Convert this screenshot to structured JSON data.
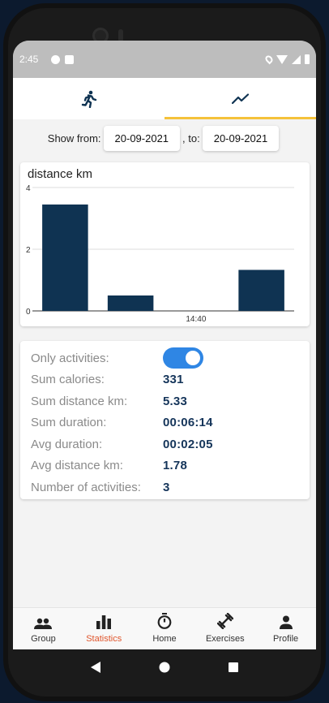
{
  "status": {
    "time": "2:45",
    "left_icons": [
      "media-icon",
      "sd-card-icon"
    ],
    "right_icons": [
      "location-icon",
      "wifi-icon",
      "signal-icon",
      "battery-icon"
    ]
  },
  "tabs": [
    {
      "icon": "running-icon",
      "active": false
    },
    {
      "icon": "trend-chart-icon",
      "active": true
    }
  ],
  "colors": {
    "accent": "#f5c23a",
    "bar": "#0f3352",
    "toggle": "#2f86e4",
    "active_nav": "#e0552c",
    "value_text": "#15355a"
  },
  "date_filter": {
    "show_from_label": "Show from:",
    "from": "20-09-2021",
    "to_label": ", to:",
    "to": "20-09-2021"
  },
  "chart_data": {
    "type": "bar",
    "title": "distance km",
    "categories": [
      "",
      "",
      "14:40",
      ""
    ],
    "values": [
      3.45,
      0.5,
      0,
      1.33
    ],
    "ylim": [
      0,
      4
    ],
    "yticks": [
      "0",
      "2",
      "4"
    ],
    "xlabel": "",
    "ylabel": "",
    "grid": true
  },
  "stats": {
    "toggle_label": "Only activities:",
    "toggle_on": true,
    "rows": [
      {
        "label": "Sum calories:",
        "value": "331"
      },
      {
        "label": "Sum distance km:",
        "value": "5.33"
      },
      {
        "label": "Sum duration:",
        "value": "00:06:14"
      },
      {
        "label": "Avg duration:",
        "value": "00:02:05"
      },
      {
        "label": "Avg distance km:",
        "value": "1.78"
      },
      {
        "label": "Number of activities:",
        "value": "3"
      }
    ]
  },
  "bottom_nav": [
    {
      "label": "Group",
      "icon": "group-icon",
      "active": false
    },
    {
      "label": "Statistics",
      "icon": "bar-chart-icon",
      "active": true
    },
    {
      "label": "Home",
      "icon": "stopwatch-icon",
      "active": false
    },
    {
      "label": "Exercises",
      "icon": "dumbbell-icon",
      "active": false
    },
    {
      "label": "Profile",
      "icon": "person-icon",
      "active": false
    }
  ]
}
